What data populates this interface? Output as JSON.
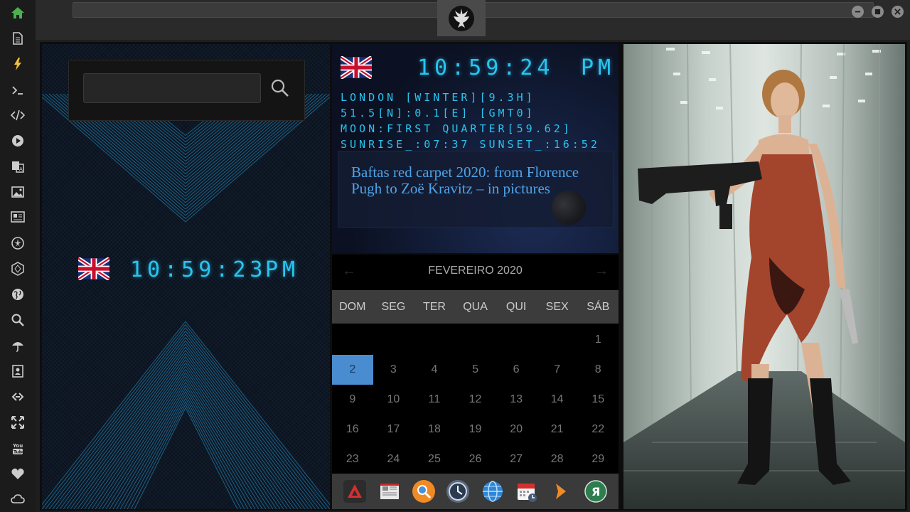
{
  "sidebar": {
    "items": [
      {
        "icon": "home-icon",
        "color": "#4caf50"
      },
      {
        "icon": "document-icon"
      },
      {
        "icon": "lightning-icon",
        "color": "#f0c040"
      },
      {
        "icon": "terminal-icon"
      },
      {
        "icon": "code-icon"
      },
      {
        "icon": "play-icon"
      },
      {
        "icon": "translate-icon"
      },
      {
        "icon": "image-icon"
      },
      {
        "icon": "news-icon"
      },
      {
        "icon": "rebel-alliance-icon"
      },
      {
        "icon": "hexagon-icon"
      },
      {
        "icon": "globe-icon"
      },
      {
        "icon": "search-icon"
      },
      {
        "icon": "umbrella-icon"
      },
      {
        "icon": "contacts-icon"
      },
      {
        "icon": "link-icon"
      },
      {
        "icon": "expand-icon"
      },
      {
        "icon": "youtube-icon"
      },
      {
        "icon": "heart-icon"
      },
      {
        "icon": "cloud-icon"
      }
    ]
  },
  "window": {
    "logo": "rebel-alliance-icon",
    "buttons": [
      "minimize-icon",
      "maximize-icon",
      "close-icon"
    ]
  },
  "search": {
    "placeholder": "",
    "value": ""
  },
  "left_clock": {
    "flag": "uk-flag",
    "time": "10:59:23",
    "ampm": "PM"
  },
  "mid_clock": {
    "flag": "uk-flag",
    "time": "10:59:24",
    "ampm": "PM"
  },
  "info": {
    "line1": "LONDON [WINTER][9.3H]",
    "line2": "51.5[N]:0.1[E] [GMT0]",
    "line3": "MOON:FIRST QUARTER[59.62]",
    "line4": "SUNRISE_:07:37 SUNSET_:16:52"
  },
  "news": {
    "title": "Baftas red carpet 2020: from Florence Pugh to Zoë Kravitz – in pictures"
  },
  "calendar": {
    "month": "FEVEREIRO 2020",
    "prev": "←",
    "next": "→",
    "weekdays": [
      "DOM",
      "SEG",
      "TER",
      "QUA",
      "QUI",
      "SEX",
      "SÁB"
    ],
    "weeks": [
      [
        "",
        "",
        "",
        "",
        "",
        "",
        "1"
      ],
      [
        "2",
        "3",
        "4",
        "5",
        "6",
        "7",
        "8"
      ],
      [
        "9",
        "10",
        "11",
        "12",
        "13",
        "14",
        "15"
      ],
      [
        "16",
        "17",
        "18",
        "19",
        "20",
        "21",
        "22"
      ],
      [
        "23",
        "24",
        "25",
        "26",
        "27",
        "28",
        "29"
      ]
    ],
    "today": "2",
    "accent": "#4a8cd0"
  },
  "dock": {
    "icons": [
      "app-red-triangle-icon",
      "news-app-icon",
      "search-app-icon",
      "clock-app-icon",
      "globe-app-icon",
      "calendar-app-icon",
      "arrow-app-icon",
      "yandex-app-icon"
    ]
  },
  "photo": {
    "subject": "woman-with-rifle-photo"
  }
}
